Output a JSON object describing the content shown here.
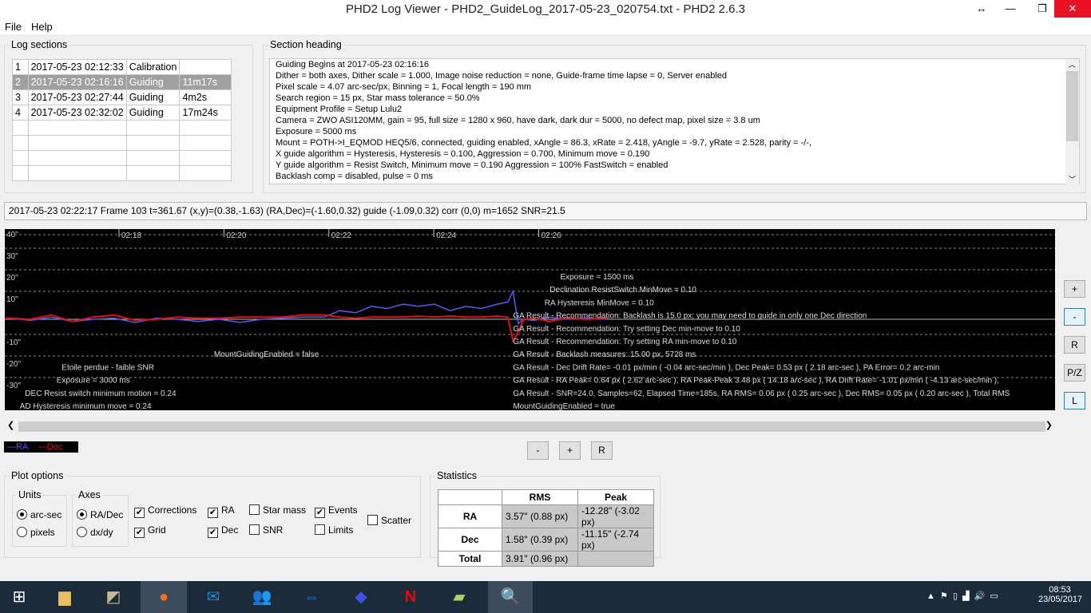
{
  "window": {
    "title": "PHD2 Log Viewer - PHD2_GuideLog_2017-05-23_020754.txt - PHD2 2.6.3"
  },
  "menu": [
    "File",
    "Help"
  ],
  "log_sections": {
    "label": "Log sections",
    "rows": [
      [
        "1",
        "2017-05-23 02:12:33",
        "Calibration",
        ""
      ],
      [
        "2",
        "2017-05-23 02:16:16",
        "Guiding",
        "11m17s"
      ],
      [
        "3",
        "2017-05-23 02:27:44",
        "Guiding",
        "4m2s"
      ],
      [
        "4",
        "2017-05-23 02:32:02",
        "Guiding",
        "17m24s"
      ]
    ]
  },
  "section_heading": {
    "label": "Section heading",
    "lines": [
      "Guiding Begins at 2017-05-23 02:16:16",
      "Dither = both axes, Dither scale = 1.000, Image noise reduction = none, Guide-frame time lapse = 0, Server enabled",
      "Pixel scale = 4.07 arc-sec/px, Binning = 1, Focal length = 190 mm",
      "Search region = 15 px, Star mass tolerance = 50.0%",
      "Equipment Profile = Setup Lulu2",
      "Camera = ZWO ASI120MM, gain = 95, full size = 1280 x 960, have dark, dark dur = 5000, no defect map, pixel size = 3.8 um",
      "Exposure = 5000 ms",
      "Mount = POTH->I_EQMOD HEQ5/6,  connected, guiding enabled, xAngle = 86.3, xRate = 2.418, yAngle = -9.7, yRate = 2.528, parity = -/-,",
      "X guide algorithm = Hysteresis, Hysteresis = 0.100, Aggression = 0.700, Minimum move = 0.190",
      "Y guide algorithm = Resist Switch, Minimum move = 0.190 Aggression = 100% FastSwitch = enabled",
      "Backlash comp = disabled, pulse = 0 ms"
    ]
  },
  "status_line": "2017-05-23 02:22:17 Frame 103 t=361.67 (x,y)=(0.38,-1.63) (RA,Dec)=(-1.60,0.32) guide (-1.09,0.32) corr (0,0) m=1652 SNR=21.5",
  "chart_data": {
    "type": "line",
    "x_unit": "minutes after 02:16",
    "x_tick_labels": [
      "02:18",
      "02:20",
      "02:22",
      "02:24",
      "02:26"
    ],
    "x_ticks": [
      2,
      4,
      6,
      8,
      10
    ],
    "xlim": [
      -1.9,
      18.1
    ],
    "y_tick_labels": [
      "40\"",
      "30\"",
      "20\"",
      "10\"",
      "",
      "-10\"",
      "-20\"",
      "-30\""
    ],
    "y_ticks": [
      40,
      30,
      20,
      10,
      0,
      -10,
      -20,
      -30
    ],
    "ylim": [
      -42,
      42
    ],
    "series": [
      {
        "name": "RA",
        "color": "#5a5af0",
        "x": [
          -1.6,
          -1.2,
          -0.8,
          -0.4,
          0,
          0.4,
          0.8,
          1.2,
          1.6,
          2.0,
          2.4,
          2.8,
          3.2,
          3.6,
          4.0,
          4.4,
          4.8,
          5.2,
          5.6,
          6.0,
          6.3,
          6.6,
          6.9,
          7.2,
          7.5,
          7.8,
          8.1,
          8.4,
          8.7,
          9.0,
          9.3,
          9.5,
          9.6,
          9.7,
          9.8,
          10.0,
          10.3,
          10.6,
          11.0,
          11.4
        ],
        "y": [
          0,
          -0.5,
          1,
          0.5,
          0.5,
          -0.5,
          1,
          -1,
          0,
          0.5,
          -1.5,
          0.5,
          0,
          -1,
          0,
          -1.5,
          0,
          0.5,
          1,
          1,
          4,
          3,
          6,
          5,
          7,
          6,
          7,
          4,
          6,
          5,
          7,
          8,
          13,
          -2,
          0,
          -0.5,
          1,
          0,
          0.5,
          0
        ]
      },
      {
        "name": "Dec",
        "color": "#e01010",
        "x": [
          -1.6,
          -1.2,
          -0.8,
          -0.4,
          0,
          0.4,
          0.8,
          1.2,
          1.6,
          2.0,
          2.4,
          2.8,
          3.2,
          3.6,
          4.0,
          4.4,
          4.8,
          5.2,
          5.6,
          6.0,
          6.3,
          6.6,
          6.9,
          7.2,
          7.5,
          7.8,
          8.1,
          8.4,
          8.7,
          9.0,
          9.3,
          9.5,
          9.6,
          9.7,
          9.8,
          10.0,
          10.3,
          10.6,
          11.0,
          11.4
        ],
        "y": [
          0,
          0.5,
          1,
          0,
          0.5,
          0,
          2,
          -1,
          1,
          2,
          -0.5,
          0,
          1,
          0.5,
          0.5,
          1,
          1,
          1,
          2,
          2,
          1,
          0.5,
          1,
          1,
          1,
          1.5,
          1,
          1.5,
          1,
          1,
          1.5,
          1,
          -10,
          -6,
          0,
          0.5,
          -1,
          0.5,
          0,
          0.5
        ]
      }
    ],
    "events": [
      {
        "text": "Exposure = 1500 ms",
        "t": 10.5,
        "y": 20
      },
      {
        "text": "Declination ResistSwitch MinMove  = 0.10",
        "t": 10.3,
        "y": 14
      },
      {
        "text": "RA Hysteresis MinMove  = 0.10",
        "t": 10.2,
        "y": 8
      },
      {
        "text": "GA Result - Recommendation: Backlash is 15.0 px; you may need to guide in only one Dec direction",
        "t": 9.6,
        "y": 2
      },
      {
        "text": "GA Result - Recommendation: Try setting Dec min-move to 0.10",
        "t": 9.6,
        "y": -4
      },
      {
        "text": "GA Result - Recommendation: Try setting RA min-move to 0.10",
        "t": 9.6,
        "y": -10
      },
      {
        "text": "GA Result - Backlash measures: 15.00 px, 5728 ms",
        "t": 9.6,
        "y": -16
      },
      {
        "text": "GA Result - Dec Drift Rate= -0.01 px/min ( -0.04 arc-sec/min ), Dec Peak=  0.53 px (  2.18 arc-sec ), PA Error= 0.2 arc-min",
        "t": 9.6,
        "y": -22
      },
      {
        "text": "GA Result - RA Peak=  0.64 px (  2.62 arc-sec ), RA Peak-Peak   3.48 px ( 14.18 arc-sec ), RA Drift Rate= -1.01 px/min ( -4.13 arc-sec/min ),",
        "t": 9.6,
        "y": -28
      },
      {
        "text": "GA Result - SNR=24.0, Samples=62, Elapsed Time=185s, RA RMS=  0.06 px (  0.25 arc-sec ), Dec RMS=  0.05 px (  0.20 arc-sec ), Total RMS",
        "t": 9.6,
        "y": -34
      },
      {
        "text": "MountGuidingEnabled = true",
        "t": 9.6,
        "y": -40
      },
      {
        "text": "MountGuidingEnabled = false",
        "t": 3.9,
        "y": -16
      },
      {
        "text": "Etoile perdue - faible SNR",
        "t": 1.0,
        "y": -22
      },
      {
        "text": "Exposure = 3000 ms",
        "t": 0.9,
        "y": -28
      },
      {
        "text": "DEC Resist switch minimum motion = 0.24",
        "t": 0.3,
        "y": -34
      },
      {
        "text": "AD Hysteresis minimum move = 0.24",
        "t": 0.2,
        "y": -40
      }
    ]
  },
  "plot_side_buttons": [
    "+",
    "-",
    "R",
    "P/Z",
    "L"
  ],
  "legend": {
    "ra": "—RA",
    "dec": "—Dec"
  },
  "zoom_buttons": [
    "-",
    "+",
    "R"
  ],
  "plot_options": {
    "label": "Plot options",
    "units_label": "Units",
    "units": [
      "arc-sec",
      "pixels"
    ],
    "axes_label": "Axes",
    "axes": [
      "RA/Dec",
      "dx/dy"
    ],
    "checks": [
      {
        "label": "Corrections",
        "checked": true
      },
      {
        "label": "Grid",
        "checked": true
      },
      {
        "label": "RA",
        "checked": true
      },
      {
        "label": "Dec",
        "checked": true
      },
      {
        "label": "Star mass",
        "checked": false
      },
      {
        "label": "SNR",
        "checked": false
      },
      {
        "label": "Events",
        "checked": true
      },
      {
        "label": "Limits",
        "checked": false
      },
      {
        "label": "Scatter",
        "checked": false
      }
    ]
  },
  "statistics": {
    "label": "Statistics",
    "headers": [
      "RMS",
      "Peak"
    ],
    "rows": [
      {
        "name": "RA",
        "rms": "3.57\" (0.88 px)",
        "peak": "-12.28\" (-3.02 px)"
      },
      {
        "name": "Dec",
        "rms": "1.58\" (0.39 px)",
        "peak": "-11.15\" (-2.74 px)"
      },
      {
        "name": "Total",
        "rms": "3.91\" (0.96 px)",
        "peak": ""
      }
    ]
  },
  "taskbar": {
    "time": "08:53",
    "date": "23/05/2017"
  }
}
